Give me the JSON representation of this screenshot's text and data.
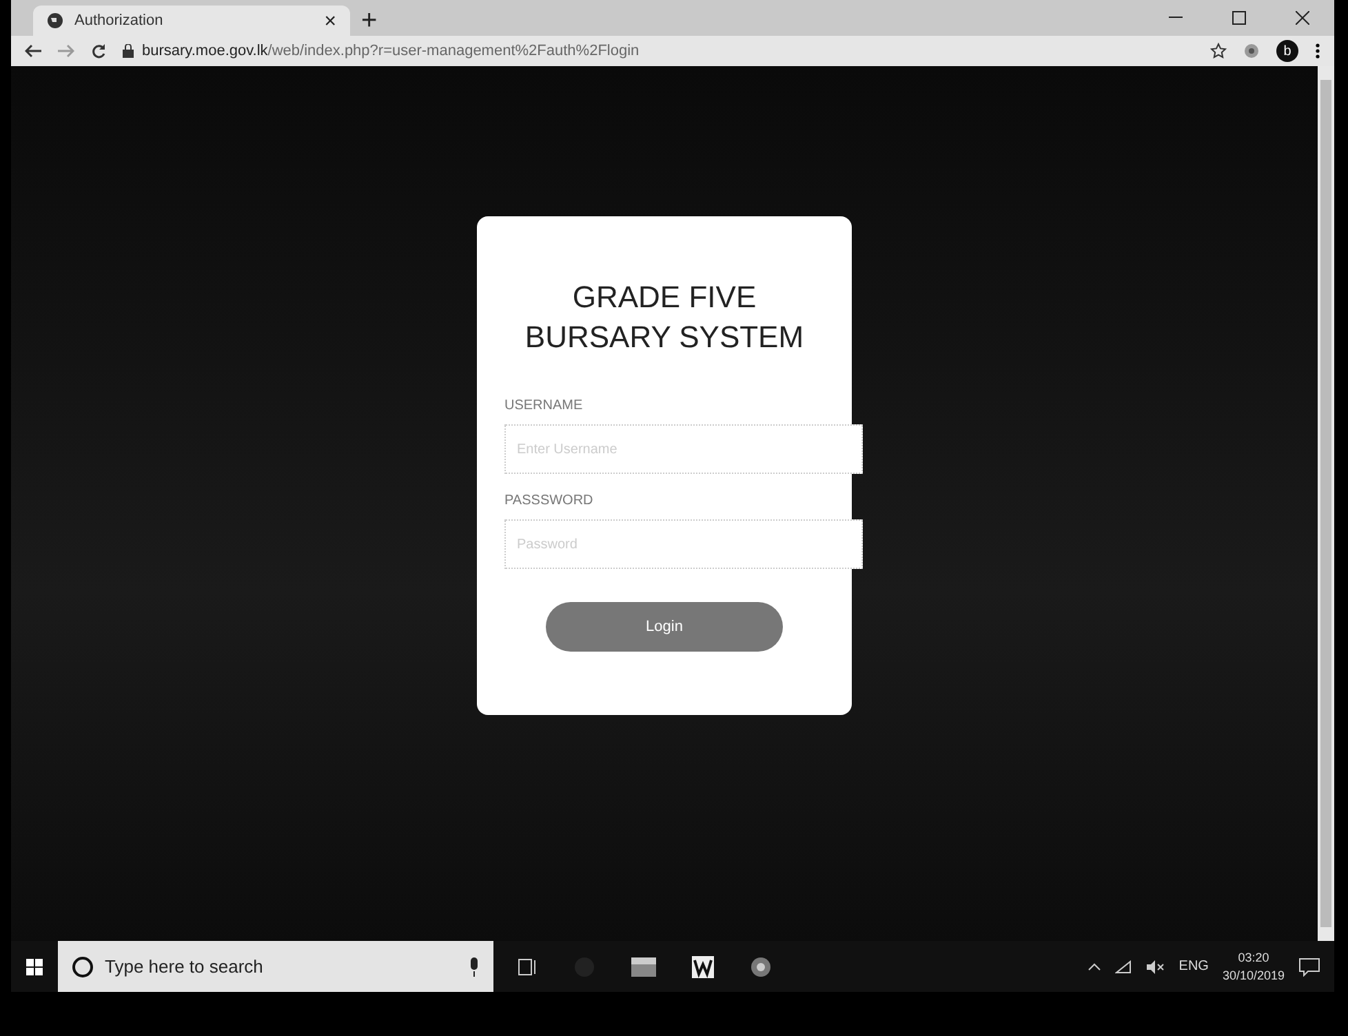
{
  "browser": {
    "tab": {
      "title": "Authorization",
      "close": "×"
    },
    "new_tab": "+",
    "address": "bursary.moe.gov.lk/web/index.php?r=user-management%2Fauth%2Flogin",
    "profile_initial": "b"
  },
  "login": {
    "title": "GRADE FIVE BURSARY SYSTEM",
    "fields": [
      {
        "label": "USERNAME",
        "placeholder": "Enter Username"
      },
      {
        "label": "PASSSWORD",
        "placeholder": "Password"
      }
    ],
    "button": "Login"
  },
  "taskbar": {
    "search_placeholder": "Type here to search",
    "language": "ENG",
    "time": "03:20",
    "date": "30/10/2019"
  }
}
